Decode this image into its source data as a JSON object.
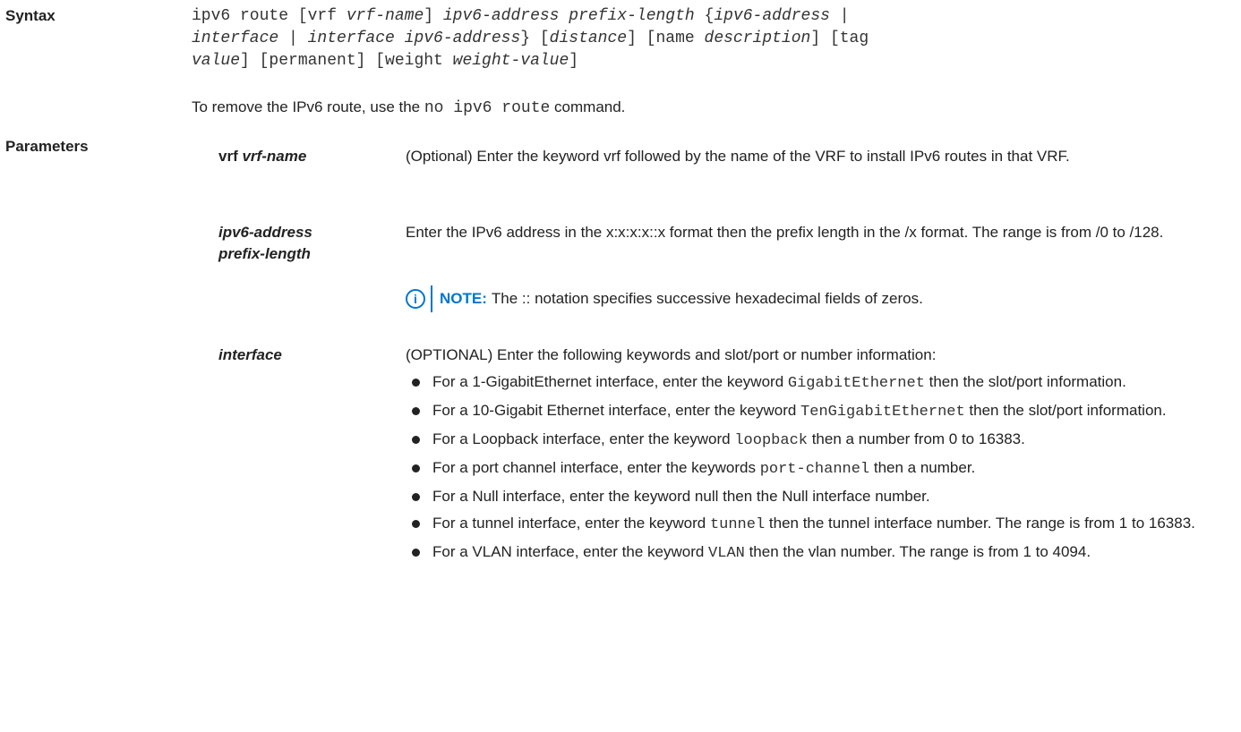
{
  "syntax": {
    "label": "Syntax",
    "line1": {
      "a": "ipv6 route [vrf ",
      "b": "vrf-name",
      "c": "] ",
      "d": "ipv6-address prefix-length",
      "e": " {",
      "f": "ipv6-address",
      "g": " |"
    },
    "line2": {
      "a": "interface",
      "b": " | ",
      "c": "interface ipv6-address",
      "d": "} [",
      "e": "distance",
      "f": "] [name ",
      "g": "description",
      "h": "] [tag"
    },
    "line3": {
      "a": "value",
      "b": "] [permanent] [weight ",
      "c": "weight-value",
      "d": "]"
    },
    "remove": {
      "before": "To remove the IPv6 route, use the ",
      "command": "no ipv6 route",
      "after": " command."
    }
  },
  "parameters": {
    "label": "Parameters",
    "vrf": {
      "term_keyword": "vrf ",
      "term_arg": "vrf-name",
      "desc": "(Optional) Enter the keyword vrf followed by the name of the VRF to install IPv6 routes in that VRF."
    },
    "ipv6": {
      "term_line1": "ipv6-address",
      "term_line2": "prefix-length",
      "desc": "Enter the IPv6 address in the x:x:x:x::x format then the prefix length in the /x format. The range is from /0 to /128.",
      "note_label": "NOTE:",
      "note_text": "The :: notation specifies successive hexadecimal fields of zeros."
    },
    "interface": {
      "term": "interface",
      "desc": "(OPTIONAL) Enter the following keywords and slot/port or number information:",
      "bullets": [
        {
          "a": "For a 1-GigabitEthernet interface, enter the keyword ",
          "code": "GigabitEthernet",
          "b": " then the slot/port information."
        },
        {
          "a": "For a 10-Gigabit Ethernet interface, enter the keyword ",
          "code": "TenGigabitEthernet",
          "b": " then the slot/port information."
        },
        {
          "a": "For a Loopback interface, enter the keyword ",
          "code": "loopback",
          "b": " then a number from 0 to 16383."
        },
        {
          "a": "For a port channel interface, enter the keywords ",
          "code": "port-channel",
          "b": " then a number."
        },
        {
          "a": "For a Null interface, enter the keyword null then the Null interface number.",
          "code": "",
          "b": ""
        },
        {
          "a": "For a tunnel interface, enter the keyword ",
          "code": "tunnel",
          "b": " then the tunnel interface number. The range is from 1 to 16383."
        },
        {
          "a": "For a VLAN interface, enter the keyword ",
          "code": "VLAN",
          "b": " then the vlan number. The range is from 1 to 4094."
        }
      ]
    }
  }
}
